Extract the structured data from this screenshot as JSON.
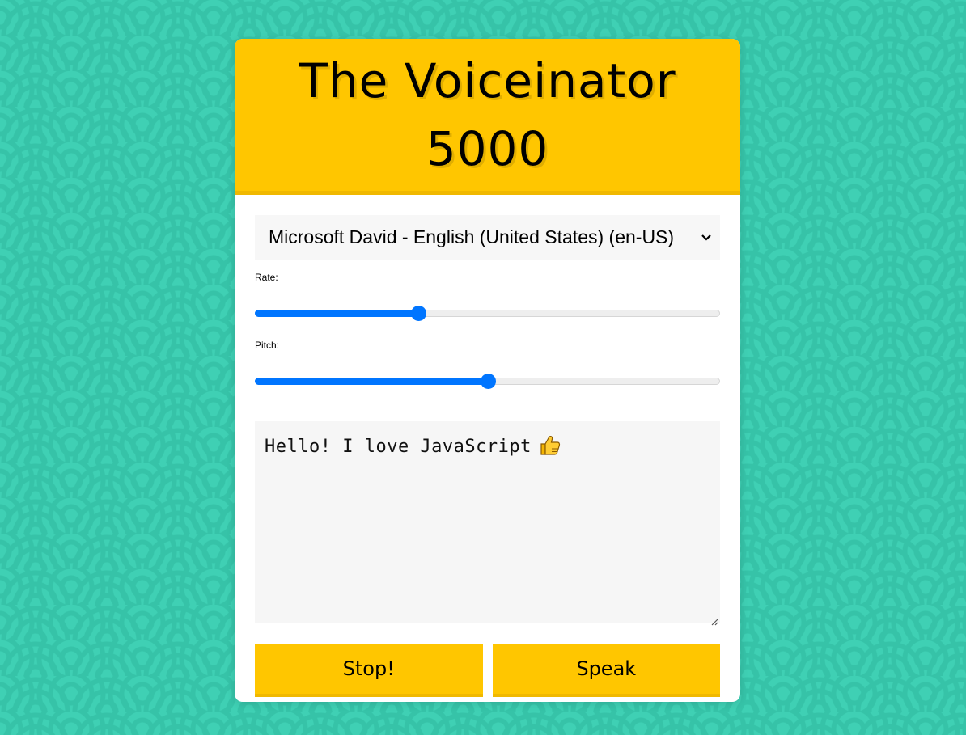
{
  "header": {
    "title_line1": "The Voiceinator",
    "title_line2": "5000"
  },
  "voice_select": {
    "selected": "Microsoft David - English (United States) (en-US)",
    "icon": "chevron-down-icon"
  },
  "rate": {
    "label": "Rate:",
    "value_fraction": 0.346
  },
  "pitch": {
    "label": "Pitch:",
    "value_fraction": 0.5
  },
  "message": {
    "text": "Hello! I love JavaScript",
    "emoji_icon": "thumbs-up-icon"
  },
  "buttons": {
    "stop_label": "Stop!",
    "speak_label": "Speak"
  },
  "colors": {
    "accent": "#ffc600",
    "slider": "#0075ff",
    "background": "#3fd0b4"
  }
}
